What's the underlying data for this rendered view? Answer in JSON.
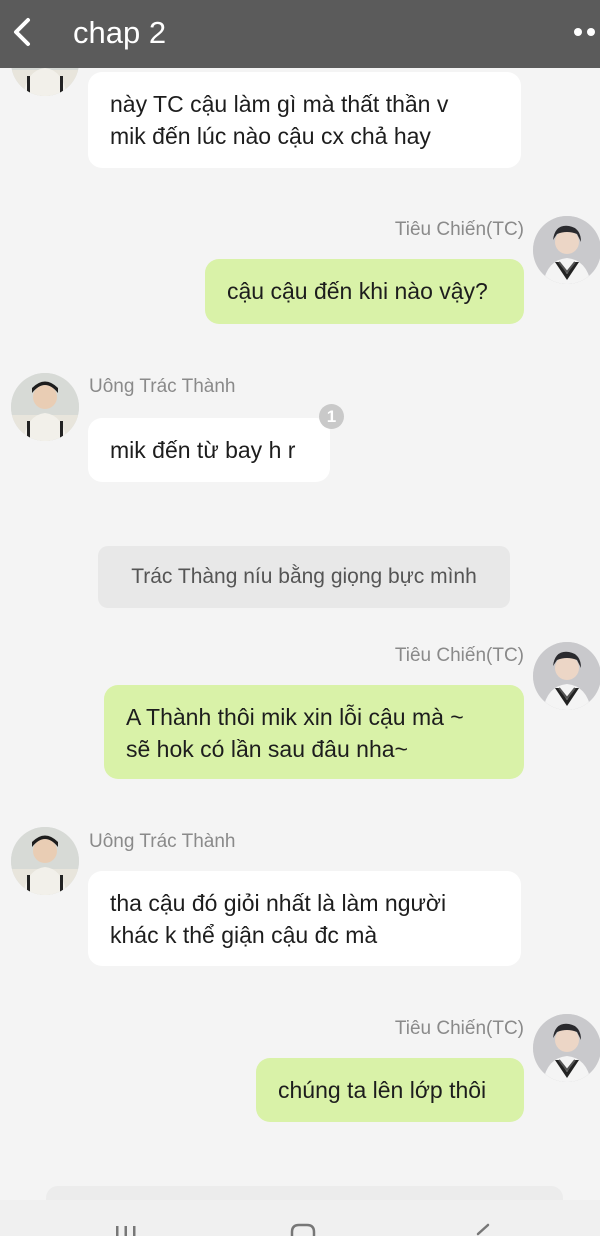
{
  "header": {
    "title": "chap 2"
  },
  "characters": {
    "left_name": "Uông Trác Thành",
    "right_name": "Tiêu Chiến(TC)"
  },
  "messages": [
    {
      "side": "left",
      "text_lines": [
        "này TC cậu làm gì mà thất thần v",
        "mik đến lúc nào cậu cx chả hay"
      ]
    },
    {
      "side": "right",
      "text_lines": [
        "cậu cậu đến khi nào vậy?"
      ]
    },
    {
      "side": "left",
      "text_lines": [
        "mik đến từ bay h r"
      ],
      "badge": "1"
    },
    {
      "side": "right",
      "text_lines": [
        "A Thành thôi mik xin lỗi cậu mà ~",
        "sẽ hok có lần sau đâu nha~"
      ]
    },
    {
      "side": "left",
      "text_lines": [
        "tha cậu đó giỏi nhất là làm người",
        "khác k thể giận cậu đc mà"
      ]
    },
    {
      "side": "right",
      "text_lines": [
        "chúng ta lên lớp thôi"
      ]
    }
  ],
  "narration": "Trác Thàng níu bằng giọng bực mình",
  "icons": {
    "back": "chevron-left-icon",
    "more": "more-dots-icon",
    "nav_recent": "recent-apps-icon",
    "nav_home": "home-icon",
    "nav_back": "nav-back-icon"
  },
  "colors": {
    "header": "#5b5b5b",
    "background": "#f4f4f4",
    "left_bubble": "#ffffff",
    "right_bubble": "#d9f2a8",
    "name_text": "#8a8a8a"
  }
}
